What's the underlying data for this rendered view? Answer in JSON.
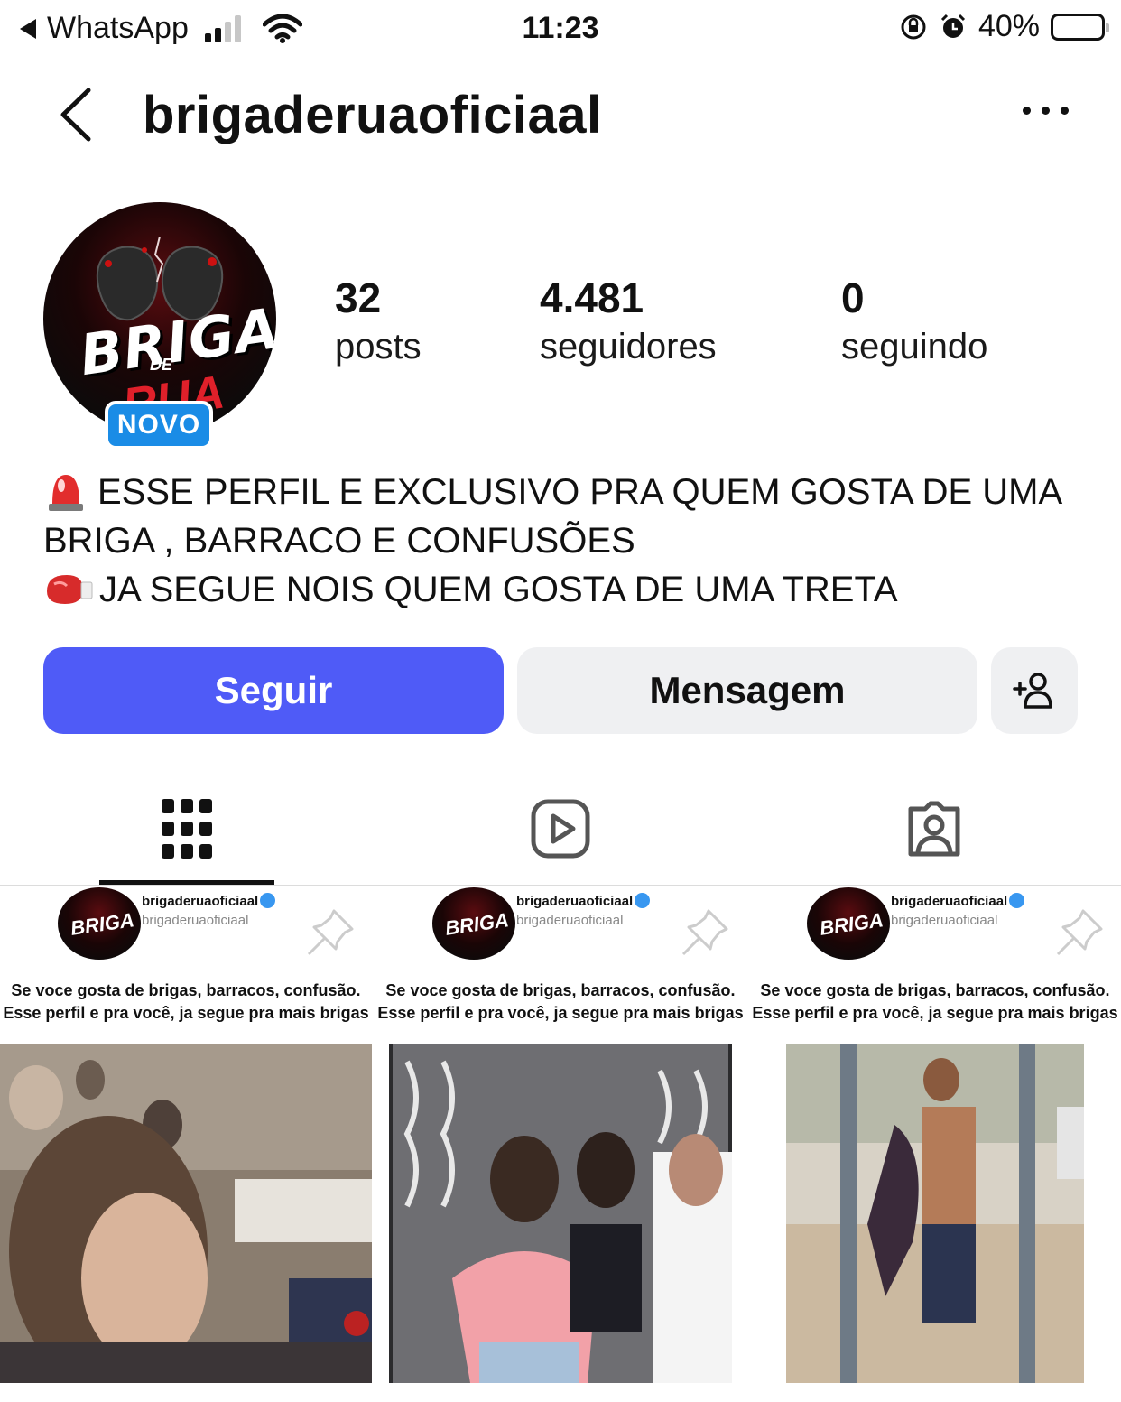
{
  "status_bar": {
    "back_app": "WhatsApp",
    "time": "11:23",
    "battery": "40%",
    "battery_level": 0.4
  },
  "header": {
    "username": "brigaderuaoficiaal"
  },
  "profile": {
    "badge": "NOVO",
    "stats": [
      {
        "value": "32",
        "label": "posts"
      },
      {
        "value": "4.481",
        "label": "seguidores"
      },
      {
        "value": "0",
        "label": "seguindo"
      }
    ],
    "bio_lines": [
      "ESSE PERFIL E EXCLUSIVO PRA QUEM GOSTA DE UMA",
      "BRIGA , BARRACO E CONFUSÕES",
      "JA SEGUE NOIS QUEM GOSTA DE UMA TRETA"
    ]
  },
  "actions": {
    "follow": "Seguir",
    "message": "Mensagem"
  },
  "tabs": [
    {
      "icon": "grid-icon",
      "active": true
    },
    {
      "icon": "reels-icon",
      "active": false
    },
    {
      "icon": "tagged-icon",
      "active": false
    }
  ],
  "posts": [
    {
      "handle": "brigaderuaoficiaal",
      "sub": "brigaderuaoficiaal",
      "logo": "BRIGA",
      "caption_1": "Se voce gosta de brigas, barracos, confusão.",
      "caption_2": "Esse perfil e pra você, ja segue pra mais brigas",
      "pinned": true
    },
    {
      "handle": "brigaderuaoficiaal",
      "sub": "brigaderuaoficiaal",
      "logo": "BRIGA",
      "caption_1": "Se voce gosta de brigas, barracos, confusão.",
      "caption_2": "Esse perfil e pra você, ja segue pra mais brigas",
      "pinned": true
    },
    {
      "handle": "brigaderuaoficiaal",
      "sub": "brigaderuaoficiaal",
      "logo": "BRIGA",
      "caption_1": "Se voce gosta de brigas, barracos, confusão.",
      "caption_2": "Esse perfil e pra você, ja segue pra mais brigas",
      "pinned": true
    }
  ],
  "logo": {
    "briga": "BRIGA",
    "de": "DE",
    "rua": "RUA"
  },
  "colors": {
    "follow_button": "#4f5bf7",
    "secondary_button": "#eff0f2",
    "badge": "#1a8ce6",
    "verified": "#3897f0"
  }
}
